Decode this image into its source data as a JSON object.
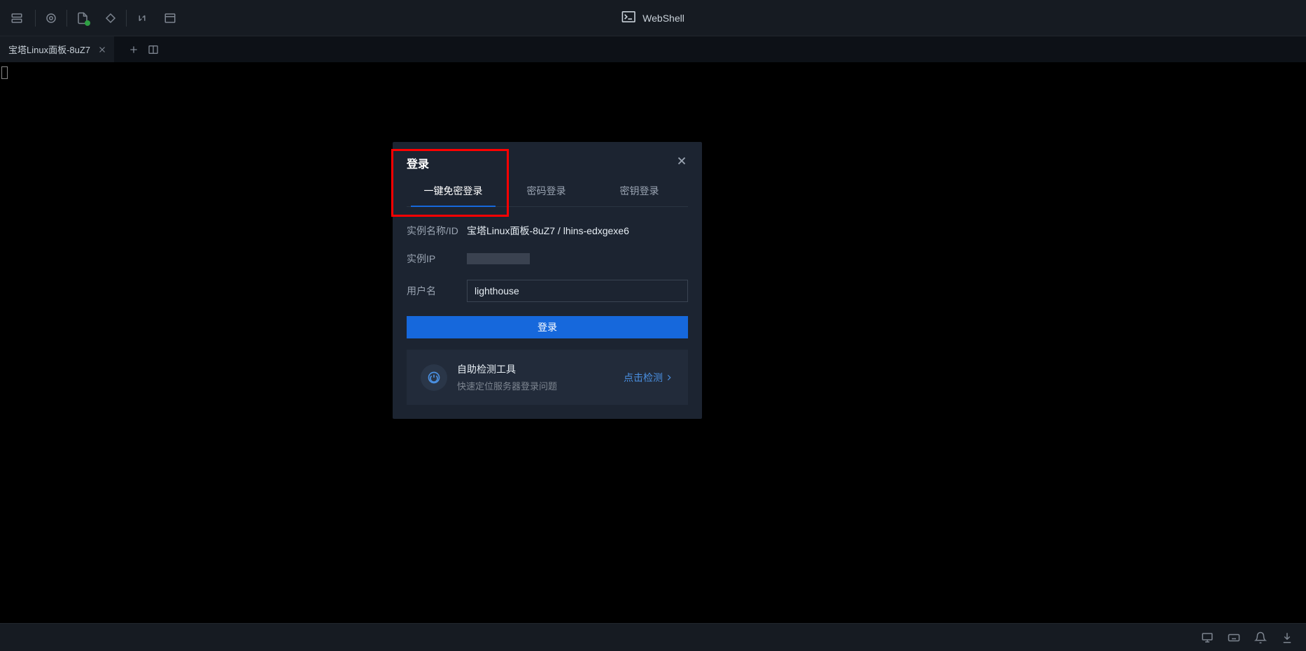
{
  "app_title": "WebShell",
  "tab": {
    "label": "宝塔Linux面板-8uZ7"
  },
  "modal": {
    "title": "登录",
    "tabs": [
      {
        "label": "一键免密登录",
        "active": true
      },
      {
        "label": "密码登录",
        "active": false
      },
      {
        "label": "密钥登录",
        "active": false
      }
    ],
    "fields": {
      "instance_label": "实例名称/ID",
      "instance_value": "宝塔Linux面板-8uZ7 / lhins-edxgexe6",
      "ip_label": "实例IP",
      "username_label": "用户名",
      "username_value": "lighthouse"
    },
    "login_button": "登录",
    "detect": {
      "title": "自助检测工具",
      "subtitle": "快速定位服务器登录问题",
      "link": "点击检测"
    }
  }
}
